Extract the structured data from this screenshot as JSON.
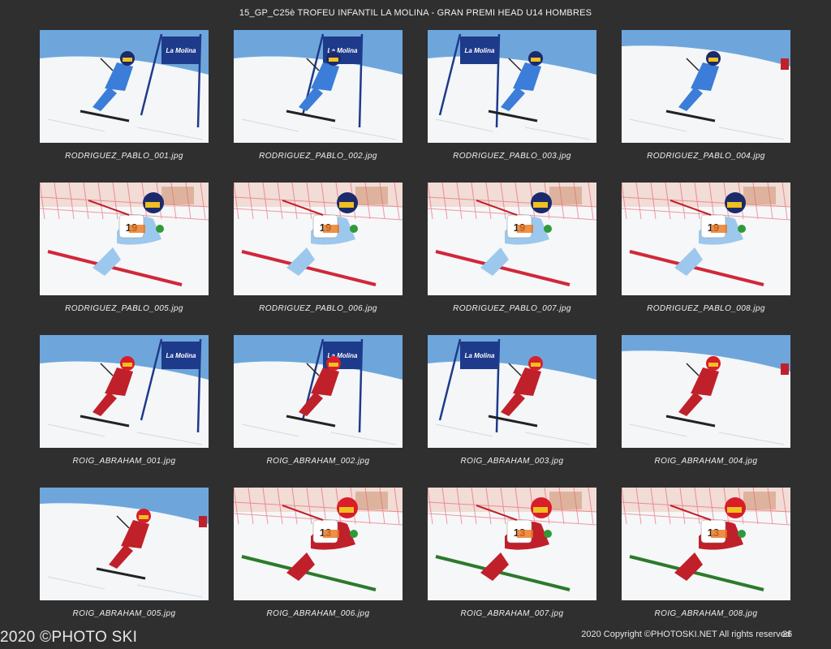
{
  "header": {
    "title": "15_GP_C25è TROFEU INFANTIL LA MOLINA - GRAN PREMI HEAD U14 HOMBRES"
  },
  "thumbnails": [
    {
      "filename": "RODRIGUEZ_PABLO_001.jpg",
      "variant": "gate",
      "suit": "blue",
      "helmet": "navy"
    },
    {
      "filename": "RODRIGUEZ_PABLO_002.jpg",
      "variant": "gate",
      "suit": "blue",
      "helmet": "navy"
    },
    {
      "filename": "RODRIGUEZ_PABLO_003.jpg",
      "variant": "gate",
      "suit": "blue",
      "helmet": "navy"
    },
    {
      "filename": "RODRIGUEZ_PABLO_004.jpg",
      "variant": "slope",
      "suit": "blue",
      "helmet": "navy"
    },
    {
      "filename": "RODRIGUEZ_PABLO_005.jpg",
      "variant": "closeup",
      "suit": "lightblue",
      "helmet": "navy",
      "bib": "19"
    },
    {
      "filename": "RODRIGUEZ_PABLO_006.jpg",
      "variant": "closeup",
      "suit": "lightblue",
      "helmet": "navy",
      "bib": "19"
    },
    {
      "filename": "RODRIGUEZ_PABLO_007.jpg",
      "variant": "closeup",
      "suit": "lightblue",
      "helmet": "navy",
      "bib": "19"
    },
    {
      "filename": "RODRIGUEZ_PABLO_008.jpg",
      "variant": "closeup",
      "suit": "lightblue",
      "helmet": "navy",
      "bib": "19"
    },
    {
      "filename": "ROIG_ABRAHAM_001.jpg",
      "variant": "gate",
      "suit": "red",
      "helmet": "red"
    },
    {
      "filename": "ROIG_ABRAHAM_002.jpg",
      "variant": "gate",
      "suit": "red",
      "helmet": "red"
    },
    {
      "filename": "ROIG_ABRAHAM_003.jpg",
      "variant": "gate",
      "suit": "red",
      "helmet": "red"
    },
    {
      "filename": "ROIG_ABRAHAM_004.jpg",
      "variant": "slope",
      "suit": "red",
      "helmet": "red"
    },
    {
      "filename": "ROIG_ABRAHAM_005.jpg",
      "variant": "slope",
      "suit": "red",
      "helmet": "red"
    },
    {
      "filename": "ROIG_ABRAHAM_006.jpg",
      "variant": "closeup",
      "suit": "red",
      "helmet": "red",
      "bib": "13"
    },
    {
      "filename": "ROIG_ABRAHAM_007.jpg",
      "variant": "closeup",
      "suit": "red",
      "helmet": "red",
      "bib": "13"
    },
    {
      "filename": "ROIG_ABRAHAM_008.jpg",
      "variant": "closeup",
      "suit": "red",
      "helmet": "red",
      "bib": "13"
    }
  ],
  "banner_text": "La Molina",
  "footer": {
    "watermark": "2020 ©PHOTO SKI",
    "copyright": "2020 Copyright ©PHOTOSKI.NET All rights reserved",
    "page_number": "26"
  },
  "colors": {
    "background": "#2f2f2f",
    "sky": "#6ea6dc",
    "snow": "#f4f6f8",
    "gate_blue": "#1e3a8a",
    "suit_blue": "#3b7dd8",
    "suit_lightblue": "#9cc8ee",
    "suit_red": "#c0202a",
    "netting": "#e84a5f"
  }
}
